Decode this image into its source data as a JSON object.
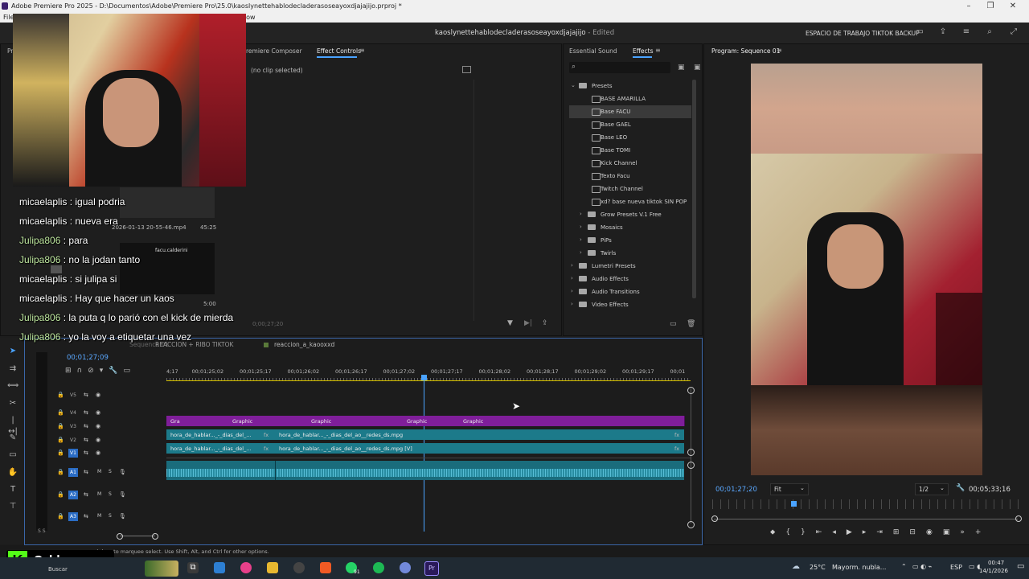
{
  "window": {
    "title": "Adobe Premiere Pro 2025 - D:\\Documentos\\Adobe\\Premiere Pro\\25.0\\kaoslynettehablodecladerasoseayoxdjajajijo.prproj *",
    "menu_first": "File",
    "menu_partial": "ndow"
  },
  "header": {
    "project_title": "kaoslynettehablodecladerasoseayoxdjajajijo",
    "project_status": "- Edited",
    "workspace": "ESPACIO DE TRABAJO TIKTOK BACKUP"
  },
  "source_panel": {
    "tab_partial": "Pr",
    "tab_composer": "remiere Composer",
    "tab_effect_controls": "Effect Controls",
    "no_clip": "(no clip selected)",
    "timecode": "0;00;27;20"
  },
  "project_panel": {
    "file_name": "2026-01-13 20-55-46.mp4",
    "file_duration": "45:25",
    "item_label": "facu.calderini",
    "item_duration": "5:00",
    "folder_partial": "Sequence"
  },
  "effects_panel": {
    "tab_essential_sound": "Essential Sound",
    "tab_effects": "Effects",
    "search_placeholder": "",
    "items": [
      {
        "label": "Presets",
        "kind": "folder",
        "level": 0,
        "open": true
      },
      {
        "label": "BASE AMARILLA",
        "kind": "preset",
        "level": 1
      },
      {
        "label": "Base FACU",
        "kind": "preset",
        "level": 1,
        "selected": true
      },
      {
        "label": "Base GAEL",
        "kind": "preset",
        "level": 1
      },
      {
        "label": "Base LEO",
        "kind": "preset",
        "level": 1
      },
      {
        "label": "Base TOMI",
        "kind": "preset",
        "level": 1
      },
      {
        "label": "Kick Channel",
        "kind": "preset",
        "level": 1
      },
      {
        "label": "Texto Facu",
        "kind": "preset",
        "level": 1
      },
      {
        "label": "Twitch Channel",
        "kind": "preset",
        "level": 1
      },
      {
        "label": "xd? base nueva tiktok SIN POP",
        "kind": "preset",
        "level": 1
      },
      {
        "label": "Grow Presets V.1 Free",
        "kind": "folder",
        "level": 1
      },
      {
        "label": "Mosaics",
        "kind": "folder",
        "level": 1
      },
      {
        "label": "PiPs",
        "kind": "folder",
        "level": 1
      },
      {
        "label": "Twirls",
        "kind": "folder",
        "level": 1
      },
      {
        "label": "Lumetri Presets",
        "kind": "folder",
        "level": 0
      },
      {
        "label": "Audio Effects",
        "kind": "folder",
        "level": 0
      },
      {
        "label": "Audio Transitions",
        "kind": "folder",
        "level": 0
      },
      {
        "label": "Video Effects",
        "kind": "folder",
        "level": 0
      }
    ]
  },
  "program_monitor": {
    "tab": "Program: Sequence 01",
    "timecode": "00;01;27;20",
    "fit": "Fit",
    "resolution": "1/2",
    "duration": "00;05;33;16"
  },
  "timeline": {
    "tab_partial": "Sequence 01",
    "tab2": "REACCION + RIBO TIKTOK",
    "tab3": "reaccion_a_kaooxxd",
    "timecode": "00;01;27;09",
    "ruler": [
      "4;17",
      "00;01;25;02",
      "00;01;25;17",
      "00;01;26;02",
      "00;01;26;17",
      "00;01;27;02",
      "00;01;27;17",
      "00;01;28;02",
      "00;01;28;17",
      "00;01;29;02",
      "00;01;29;17",
      "00;01"
    ],
    "tracks": [
      "V5",
      "V4",
      "V3",
      "V2",
      "V1",
      "A1",
      "A2",
      "A3"
    ],
    "graphic_clips": [
      "Gra",
      "Graphic",
      "Graphic",
      "Graphic",
      "Graphic"
    ],
    "v2_clips": [
      "hora_de_hablar..._-_dias_del_...",
      "hora_de_hablar..._-_dias_del_ao__redes_ds.mpg"
    ],
    "v1_clips": [
      "hora_de_hablar..._-_dias_del_...",
      "hora_de_hablar..._-_dias_del_ao__redes_ds.mpg [V]"
    ],
    "fx_badge": "fx",
    "track_btn_m": "M",
    "track_btn_s": "S",
    "meter_label": "S S"
  },
  "status_bar": {
    "hint": "d drag to marquee select. Use Shift, Alt, and Ctrl for other options."
  },
  "overlay": {
    "brand": "Caldeerass",
    "brand_icon": "K"
  },
  "chat": [
    {
      "user": "micaelaplis",
      "msg": "igual podria",
      "color": "#ffffff"
    },
    {
      "user": "micaelaplis",
      "msg": "nueva era",
      "color": "#ffffff"
    },
    {
      "user": "Julipa806",
      "msg": "para",
      "color": "#bfe8a0"
    },
    {
      "user": "Julipa806",
      "msg": "no la jodan tanto",
      "color": "#bfe8a0"
    },
    {
      "user": "micaelaplis",
      "msg": "si julipa si",
      "color": "#ffffff"
    },
    {
      "user": "micaelaplis",
      "msg": "Hay que hacer un kaos",
      "color": "#ffffff"
    },
    {
      "user": "Julipa806",
      "msg": "la puta q lo parió con el kick de mierda",
      "color": "#bfe8a0"
    },
    {
      "user": "Julipa806",
      "msg": "yo la voy a etiquetar una vez",
      "color": "#bfe8a0"
    }
  ],
  "taskbar": {
    "search_partial": "Buscar",
    "badge": "91",
    "weather_temp": "25°C",
    "weather_desc": "Mayorm. nubla...",
    "lang": "ESP",
    "time": "00:47",
    "date": "14/1/2026"
  }
}
